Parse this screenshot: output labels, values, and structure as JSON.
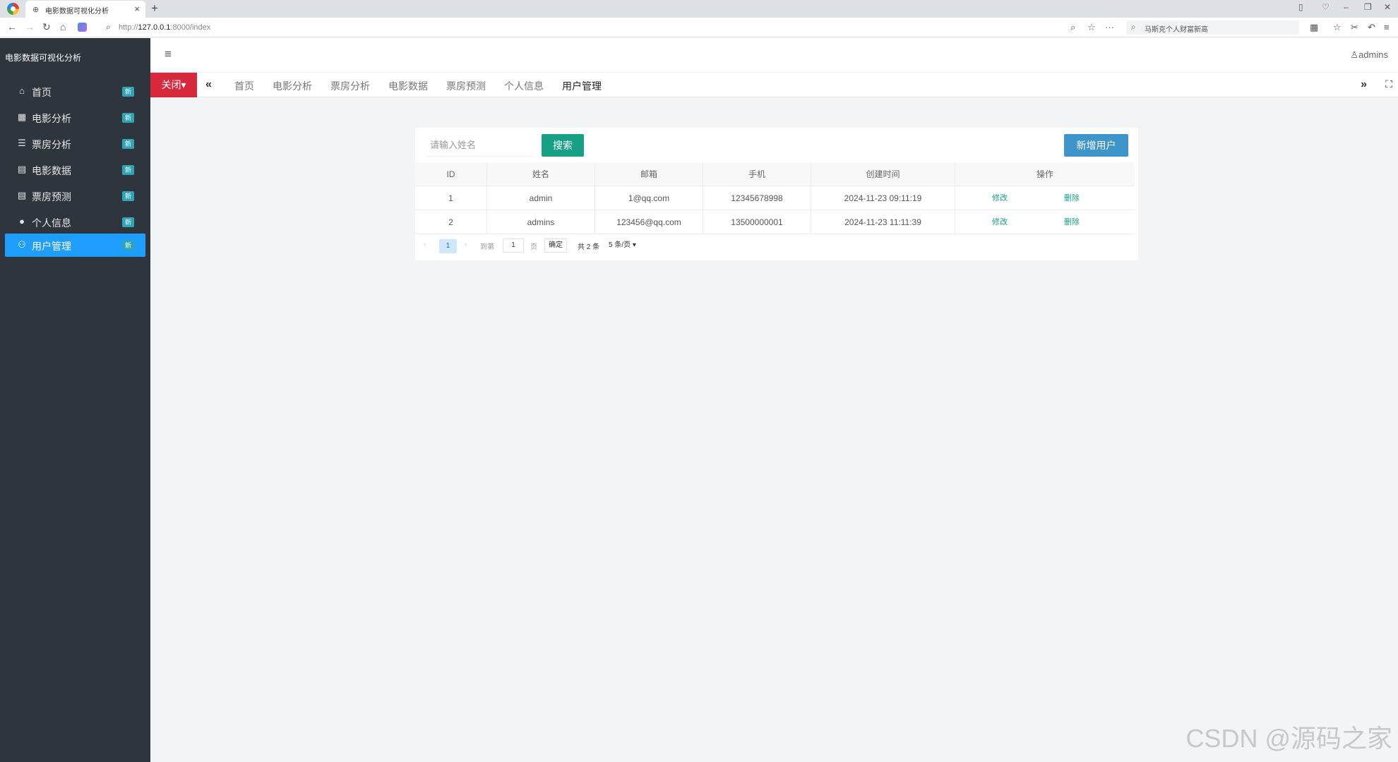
{
  "browser": {
    "tab_title": "电影数据可视化分析",
    "url_prefix": "http://",
    "url_host": "127.0.0.1",
    "url_rest": ":8000/index",
    "search_text": "马斯克个人财富新高"
  },
  "sidebar": {
    "brand": "电影数据可视化分析",
    "badge": "新",
    "items": [
      {
        "label": "首页",
        "icon": "home-icon",
        "glyph": "⌂"
      },
      {
        "label": "电影分析",
        "icon": "table-icon",
        "glyph": "▦"
      },
      {
        "label": "票房分析",
        "icon": "list-icon",
        "glyph": "☰"
      },
      {
        "label": "电影数据",
        "icon": "grid-icon",
        "glyph": "▤"
      },
      {
        "label": "票房预测",
        "icon": "grid-icon",
        "glyph": "▤"
      },
      {
        "label": "个人信息",
        "icon": "user-icon",
        "glyph": "●"
      },
      {
        "label": "用户管理",
        "icon": "users-icon",
        "glyph": "⚇"
      }
    ],
    "active_index": 6
  },
  "header": {
    "user": "admins",
    "close_label": "关闭▾",
    "tabs": [
      "首页",
      "电影分析",
      "票房分析",
      "电影数据",
      "票房预测",
      "个人信息",
      "用户管理"
    ],
    "active_tab": "用户管理"
  },
  "toolbar": {
    "search_placeholder": "请输入姓名",
    "search_label": "搜索",
    "add_label": "新增用户"
  },
  "table": {
    "columns": [
      "ID",
      "姓名",
      "邮箱",
      "手机",
      "创建时间",
      "操作"
    ],
    "rows": [
      {
        "id": "1",
        "name": "admin",
        "email": "1@qq.com",
        "phone": "12345678998",
        "created": "2024-11-23 09:11:19"
      },
      {
        "id": "2",
        "name": "admins",
        "email": "123456@qq.com",
        "phone": "13500000001",
        "created": "2024-11-23 11:11:39"
      }
    ],
    "edit_label": "修改",
    "delete_label": "删除"
  },
  "pagination": {
    "current": "1",
    "goto_label": "到第",
    "goto_value": "1",
    "page_unit": "页",
    "confirm_label": "确定",
    "total": "共 2 条",
    "page_size": "5 条/页"
  },
  "watermark": "CSDN @源码之家"
}
